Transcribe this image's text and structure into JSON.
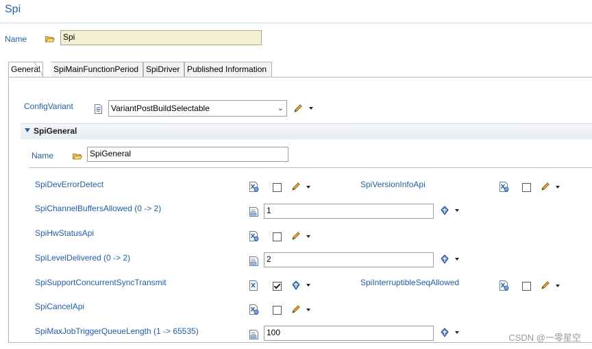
{
  "page": {
    "title": "Spi"
  },
  "top_field": {
    "label": "Name",
    "value": "Spi"
  },
  "tabs": [
    {
      "label": "General"
    },
    {
      "label": "SpiMainFunctionPeriod"
    },
    {
      "label": "SpiDriver"
    },
    {
      "label": "Published Information"
    }
  ],
  "config_variant": {
    "label": "ConfigVariant",
    "value": "VariantPostBuildSelectable"
  },
  "section": {
    "title": "SpiGeneral",
    "name_label": "Name",
    "name_value": "SpiGeneral"
  },
  "params": {
    "dev_error_detect": {
      "label": "SpiDevErrorDetect",
      "checked": false
    },
    "version_info_api": {
      "label": "SpiVersionInfoApi",
      "checked": false
    },
    "channel_buffers_allowed": {
      "label": "SpiChannelBuffersAllowed (0 -> 2)",
      "value": "1"
    },
    "hw_status_api": {
      "label": "SpiHwStatusApi",
      "checked": false
    },
    "level_delivered": {
      "label": "SpiLevelDelivered (0 -> 2)",
      "value": "2"
    },
    "support_concurrent_sync": {
      "label": "SpiSupportConcurrentSyncTransmit",
      "checked": true
    },
    "interruptible_seq_allowed": {
      "label": "SpiInterruptibleSeqAllowed",
      "checked": false
    },
    "cancel_api": {
      "label": "SpiCancelApi",
      "checked": false
    },
    "max_job_trigger_queue_length": {
      "label": "SpiMaxJobTriggerQueueLength (1 -> 65535)",
      "value": "100"
    }
  },
  "watermark": "CSDN @一零星空",
  "icons": {
    "folder": "folder-open-icon",
    "doc": "document-icon",
    "config": "config-x-icon",
    "number": "number-field-icon",
    "pencil": "pencil-icon",
    "calc": "calculated-value-icon"
  },
  "colors": {
    "label_blue": "#1f5fa8",
    "name_field_bg": "#f3f1d2"
  }
}
